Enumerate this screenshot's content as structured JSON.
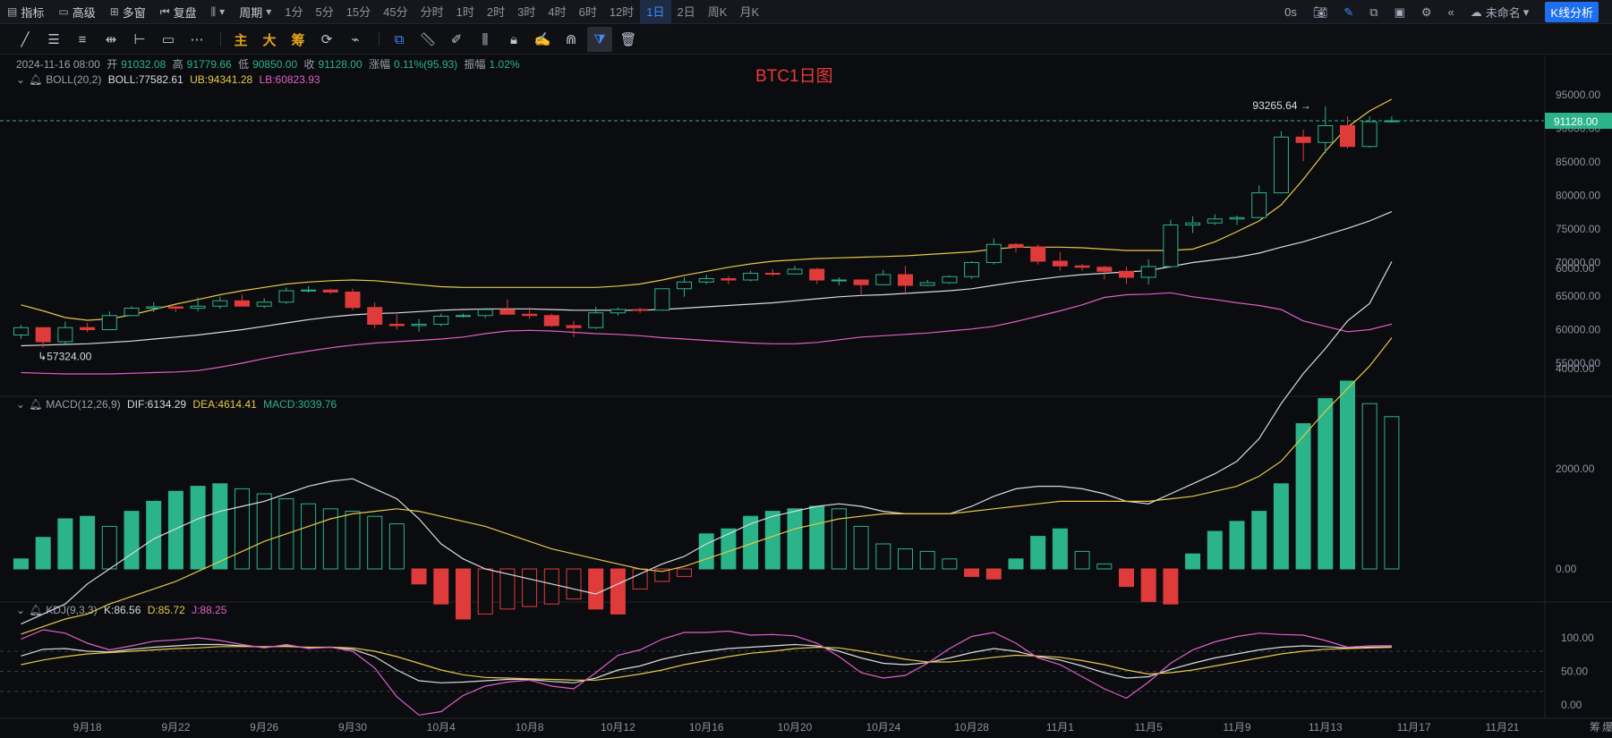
{
  "topbar": {
    "indicators_label": "指标",
    "advanced_label": "高级",
    "multiwindow_label": "多窗",
    "replay_label": "复盘",
    "period_label": "周期",
    "timeframes": [
      "1分",
      "5分",
      "15分",
      "45分",
      "分时",
      "1时",
      "2时",
      "3时",
      "4时",
      "6时",
      "12时",
      "1日",
      "2日",
      "周K",
      "月K"
    ],
    "active_timeframe": "1日",
    "countdown": "0s",
    "layout_name": "未命名",
    "kline_button": "K线分析"
  },
  "drawing_toolbar": {
    "main_label": "主",
    "large_label": "大",
    "chip_label": "筹"
  },
  "ohlc": {
    "date": "2024-11-16 08:00",
    "open_label": "开",
    "open": "91032.08",
    "high_label": "高",
    "high": "91779.66",
    "low_label": "低",
    "low": "90850.00",
    "close_label": "收",
    "close": "91128.00",
    "change_label": "涨幅",
    "change": "0.11%(95.93)",
    "amplitude_label": "振幅",
    "amplitude": "1.02%"
  },
  "boll": {
    "name": "BOLL(20,2)",
    "boll": "BOLL:77582.61",
    "ub": "UB:94341.28",
    "lb": "LB:60823.93"
  },
  "macd": {
    "name": "MACD(12,26,9)",
    "dif": "DIF:6134.29",
    "dea": "DEA:4614.41",
    "macd": "MACD:3039.76"
  },
  "kdj": {
    "name": "KDJ(9,3,3)",
    "k": "K:86.56",
    "d": "D:85.72",
    "j": "J:88.25"
  },
  "watermark": "BTC1日图",
  "colors": {
    "up": "#2bb38a",
    "down": "#e03b3b",
    "boll_mid": "#d8dbe0",
    "boll_ub": "#e6c84a",
    "boll_lb": "#e060c8",
    "accent": "#1e6ef0"
  },
  "chart_data": [
    {
      "type": "candlestick",
      "title": "BTC1日图",
      "x": [
        "9-15",
        "9-16",
        "9-17",
        "9-18",
        "9-19",
        "9-20",
        "9-21",
        "9-22",
        "9-23",
        "9-24",
        "9-25",
        "9-26",
        "9-27",
        "9-28",
        "9-29",
        "9-30",
        "10-1",
        "10-2",
        "10-3",
        "10-4",
        "10-5",
        "10-6",
        "10-7",
        "10-8",
        "10-9",
        "10-10",
        "10-11",
        "10-12",
        "10-13",
        "10-14",
        "10-15",
        "10-16",
        "10-17",
        "10-18",
        "10-19",
        "10-20",
        "10-21",
        "10-22",
        "10-23",
        "10-24",
        "10-25",
        "10-26",
        "10-27",
        "10-28",
        "10-29",
        "10-30",
        "10-31",
        "11-1",
        "11-2",
        "11-3",
        "11-4",
        "11-5",
        "11-6",
        "11-7",
        "11-8",
        "11-9",
        "11-10",
        "11-11",
        "11-12",
        "11-13",
        "11-14",
        "11-15",
        "11-16"
      ],
      "x_tick_labels": [
        "9月18",
        "9月22",
        "9月26",
        "9月30",
        "10月4",
        "10月8",
        "10月12",
        "10月16",
        "10月20",
        "10月24",
        "10月28",
        "11月1",
        "11月5",
        "11月9",
        "11月13",
        "11月17",
        "11月21"
      ],
      "ohlc": [
        [
          59200,
          60700,
          58600,
          60300
        ],
        [
          60300,
          60400,
          57324,
          58200
        ],
        [
          58200,
          61200,
          57900,
          60300
        ],
        [
          60300,
          61000,
          59600,
          60000
        ],
        [
          60000,
          62700,
          59900,
          62100
        ],
        [
          62100,
          63500,
          62100,
          63200
        ],
        [
          63200,
          64100,
          62600,
          63400
        ],
        [
          63400,
          63500,
          62600,
          63200
        ],
        [
          63200,
          64800,
          62700,
          63500
        ],
        [
          63500,
          64900,
          63100,
          64300
        ],
        [
          64300,
          65200,
          63900,
          63500
        ],
        [
          63500,
          64700,
          63200,
          64100
        ],
        [
          64100,
          66300,
          63800,
          65800
        ],
        [
          65800,
          66500,
          65500,
          65900
        ],
        [
          65900,
          66100,
          65300,
          65600
        ],
        [
          65600,
          66100,
          62900,
          63300
        ],
        [
          63300,
          64100,
          60200,
          60800
        ],
        [
          60800,
          62300,
          60000,
          60600
        ],
        [
          60600,
          61600,
          59700,
          60800
        ],
        [
          60800,
          62400,
          60500,
          62000
        ],
        [
          62000,
          62400,
          61800,
          62100
        ],
        [
          62100,
          62900,
          61700,
          63000
        ],
        [
          63000,
          64500,
          62300,
          62300
        ],
        [
          62300,
          63300,
          61600,
          62100
        ],
        [
          62100,
          62400,
          60400,
          60600
        ],
        [
          60600,
          61300,
          58900,
          60300
        ],
        [
          60300,
          63400,
          60100,
          62500
        ],
        [
          62500,
          63300,
          62100,
          63000
        ],
        [
          63000,
          63300,
          62500,
          62900
        ],
        [
          62900,
          66100,
          62800,
          66100
        ],
        [
          66100,
          67800,
          64900,
          67100
        ],
        [
          67100,
          68200,
          66800,
          67600
        ],
        [
          67600,
          68000,
          66800,
          67400
        ],
        [
          67400,
          68800,
          67200,
          68400
        ],
        [
          68400,
          69000,
          68000,
          68300
        ],
        [
          68300,
          69500,
          68200,
          69000
        ],
        [
          69000,
          69200,
          66800,
          67400
        ],
        [
          67400,
          67800,
          66600,
          67400
        ],
        [
          67400,
          67500,
          65300,
          66700
        ],
        [
          66700,
          68900,
          66600,
          68200
        ],
        [
          68200,
          69500,
          65600,
          66600
        ],
        [
          66600,
          67400,
          66500,
          67000
        ],
        [
          67000,
          68100,
          66800,
          67900
        ],
        [
          67900,
          70200,
          67600,
          70000
        ],
        [
          70000,
          73600,
          69700,
          72700
        ],
        [
          72700,
          72900,
          71500,
          72300
        ],
        [
          72300,
          72700,
          69700,
          70200
        ],
        [
          70200,
          71600,
          68800,
          69500
        ],
        [
          69500,
          69800,
          68800,
          69300
        ],
        [
          69300,
          69500,
          67500,
          68700
        ],
        [
          68700,
          69400,
          66800,
          67800
        ],
        [
          67800,
          70500,
          66700,
          69400
        ],
        [
          69400,
          76400,
          69200,
          75600
        ],
        [
          75600,
          76900,
          74400,
          75900
        ],
        [
          75900,
          77200,
          75600,
          76500
        ],
        [
          76500,
          77000,
          75600,
          76700
        ],
        [
          76700,
          81500,
          76600,
          80400
        ],
        [
          80400,
          89600,
          80300,
          88700
        ],
        [
          88700,
          89800,
          85100,
          87900
        ],
        [
          87900,
          93265.64,
          86300,
          90400
        ],
        [
          90400,
          91800,
          87000,
          87300
        ],
        [
          87300,
          91800,
          87100,
          91000
        ],
        [
          91032.08,
          91779.66,
          90850,
          91128
        ]
      ],
      "boll_mid": [
        57600,
        57700,
        57800,
        57900,
        58100,
        58300,
        58600,
        58900,
        59200,
        59600,
        60000,
        60500,
        61000,
        61500,
        61900,
        62200,
        62400,
        62500,
        62700,
        62900,
        63000,
        63100,
        63100,
        63100,
        63000,
        62900,
        62900,
        62900,
        62900,
        63000,
        63200,
        63400,
        63600,
        63800,
        64000,
        64300,
        64600,
        64900,
        65100,
        65200,
        65400,
        65600,
        65800,
        66100,
        66600,
        67100,
        67500,
        67900,
        68200,
        68400,
        68600,
        68800,
        69400,
        70000,
        70400,
        70800,
        71400,
        72300,
        73100,
        74100,
        75100,
        76200,
        77582.61
      ],
      "boll_ub": [
        63700,
        62800,
        61800,
        61400,
        61600,
        62200,
        63000,
        63800,
        64500,
        65200,
        65800,
        66300,
        66800,
        67100,
        67300,
        67400,
        67300,
        67000,
        66700,
        66400,
        66300,
        66300,
        66300,
        66300,
        66300,
        66300,
        66300,
        66500,
        66800,
        67400,
        68100,
        68700,
        69300,
        69800,
        70200,
        70400,
        70600,
        70700,
        70800,
        70900,
        71000,
        71200,
        71400,
        71600,
        72000,
        72300,
        72300,
        72300,
        72200,
        72000,
        71800,
        71800,
        71800,
        72000,
        73100,
        74600,
        76200,
        78600,
        82400,
        86600,
        90200,
        92600,
        94341.28
      ],
      "boll_lb": [
        53600,
        53500,
        53400,
        53400,
        53400,
        53500,
        53600,
        53700,
        53900,
        54400,
        55000,
        55700,
        56300,
        56800,
        57300,
        57700,
        58000,
        58200,
        58400,
        58600,
        58900,
        59400,
        59800,
        59900,
        59800,
        59600,
        59400,
        59300,
        59100,
        58800,
        58600,
        58400,
        58200,
        58000,
        57900,
        57900,
        58100,
        58500,
        58900,
        59100,
        59300,
        59500,
        59800,
        60100,
        60500,
        61200,
        62000,
        62800,
        63700,
        64800,
        65200,
        65300,
        65500,
        64900,
        64500,
        64000,
        63600,
        63000,
        61300,
        60500,
        59700,
        60000,
        60823.93
      ],
      "price_axis": {
        "ticks": [
          "95000.00",
          "90000.00",
          "85000.00",
          "80000.00",
          "75000.00",
          "70000.00",
          "65000.00",
          "60000.00",
          "55000.00"
        ],
        "current": "91128.00",
        "high_mark": "93265.64",
        "low_mark": "57324.00"
      }
    },
    {
      "type": "bar",
      "title": "MACD(12,26,9)",
      "x_ref": "same as candlestick",
      "hist": [
        200,
        630,
        1000,
        1050,
        850,
        1150,
        1350,
        1550,
        1650,
        1700,
        1600,
        1500,
        1400,
        1300,
        1200,
        1150,
        1050,
        900,
        -300,
        -700,
        -1000,
        -900,
        -800,
        -750,
        -700,
        -600,
        -800,
        -900,
        -400,
        -250,
        -150,
        700,
        800,
        1050,
        1150,
        1200,
        1250,
        1200,
        850,
        500,
        400,
        350,
        200,
        -150,
        -200,
        200,
        650,
        800,
        350,
        100,
        -350,
        -650,
        -700,
        300,
        750,
        950,
        1150,
        1700,
        2900,
        3400,
        3750,
        3300,
        3039.76
      ],
      "dif": [
        -1100,
        -900,
        -700,
        -300,
        0,
        300,
        600,
        800,
        1000,
        1150,
        1250,
        1350,
        1500,
        1650,
        1750,
        1800,
        1600,
        1400,
        1000,
        500,
        200,
        0,
        -100,
        -200,
        -300,
        -400,
        -500,
        -300,
        -100,
        100,
        250,
        500,
        700,
        900,
        1050,
        1150,
        1250,
        1300,
        1250,
        1150,
        1100,
        1100,
        1100,
        1250,
        1450,
        1600,
        1650,
        1650,
        1600,
        1500,
        1350,
        1300,
        1500,
        1700,
        1900,
        2150,
        2600,
        3300,
        3900,
        4400,
        4950,
        5300,
        6134.29
      ],
      "dea": [
        -1300,
        -1150,
        -1000,
        -900,
        -700,
        -550,
        -400,
        -250,
        -50,
        150,
        350,
        550,
        700,
        850,
        1000,
        1100,
        1150,
        1200,
        1150,
        1050,
        950,
        850,
        700,
        550,
        400,
        300,
        200,
        100,
        0,
        -50,
        50,
        200,
        350,
        500,
        650,
        800,
        900,
        1000,
        1050,
        1100,
        1100,
        1100,
        1100,
        1150,
        1200,
        1250,
        1300,
        1350,
        1350,
        1350,
        1350,
        1350,
        1400,
        1450,
        1550,
        1650,
        1850,
        2150,
        2650,
        3150,
        3600,
        4050,
        4614.41
      ],
      "y_ticks": [
        "6000.00",
        "4000.00",
        "2000.00",
        "0.00"
      ]
    },
    {
      "type": "line",
      "title": "KDJ(9,3,3)",
      "x_ref": "same as candlestick",
      "k": [
        73,
        83,
        84,
        80,
        79,
        83,
        86,
        88,
        90,
        90,
        88,
        86,
        88,
        85,
        86,
        83,
        72,
        52,
        36,
        33,
        34,
        36,
        38,
        38,
        35,
        33,
        40,
        52,
        58,
        68,
        75,
        80,
        84,
        86,
        88,
        90,
        88,
        80,
        70,
        62,
        60,
        63,
        70,
        78,
        84,
        80,
        72,
        67,
        58,
        48,
        40,
        42,
        53,
        62,
        70,
        76,
        82,
        86,
        88,
        87,
        85,
        86,
        86.56
      ],
      "d": [
        60,
        67,
        72,
        76,
        78,
        80,
        82,
        84,
        85,
        87,
        87,
        87,
        87,
        86,
        86,
        85,
        80,
        72,
        62,
        52,
        45,
        41,
        40,
        39,
        38,
        37,
        37,
        41,
        46,
        52,
        60,
        66,
        72,
        77,
        80,
        84,
        86,
        85,
        80,
        74,
        68,
        64,
        64,
        67,
        71,
        74,
        73,
        71,
        66,
        60,
        52,
        46,
        48,
        52,
        58,
        64,
        70,
        76,
        80,
        83,
        84,
        85,
        85.72
      ],
      "j": [
        98,
        112,
        107,
        92,
        82,
        88,
        95,
        97,
        100,
        96,
        90,
        85,
        90,
        84,
        86,
        80,
        55,
        12,
        -15,
        -10,
        14,
        28,
        34,
        37,
        28,
        24,
        48,
        74,
        82,
        98,
        108,
        108,
        110,
        104,
        105,
        103,
        92,
        72,
        48,
        40,
        44,
        62,
        84,
        102,
        108,
        92,
        70,
        60,
        42,
        24,
        10,
        34,
        62,
        82,
        94,
        102,
        107,
        105,
        104,
        96,
        86,
        88,
        88.25
      ],
      "y_ticks": [
        "100.00",
        "50.00",
        "0.00"
      ]
    }
  ]
}
